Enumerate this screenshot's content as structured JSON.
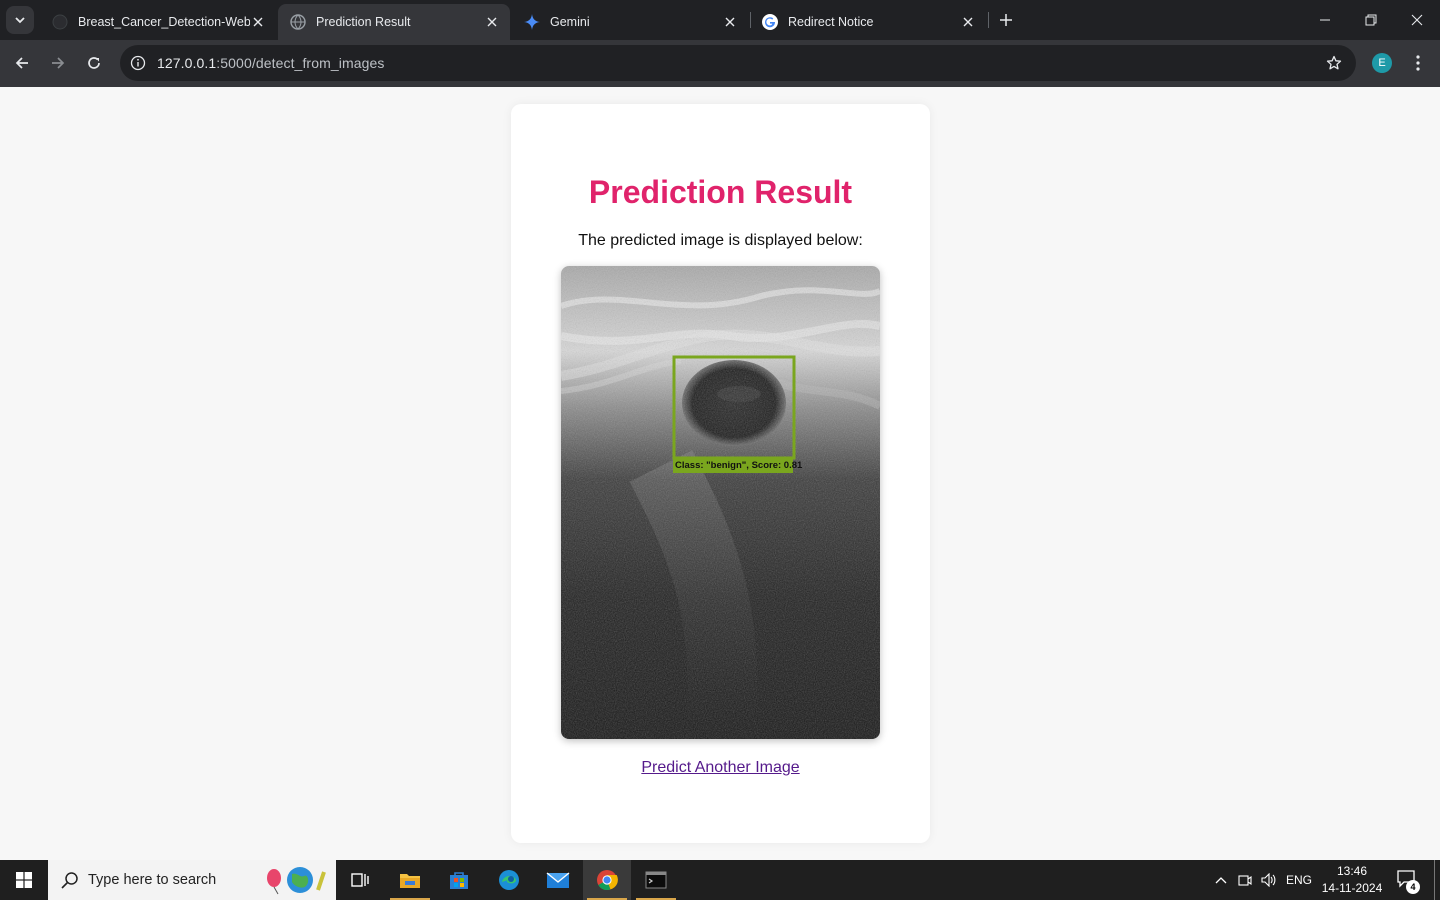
{
  "browser": {
    "tabs": [
      {
        "title": "Breast_Cancer_Detection-Web_",
        "active": false,
        "favicon": "github-icon"
      },
      {
        "title": "Prediction Result",
        "active": true,
        "favicon": "globe-icon"
      },
      {
        "title": "Gemini",
        "active": false,
        "favicon": "gemini-sparkle-icon"
      },
      {
        "title": "Redirect Notice",
        "active": false,
        "favicon": "google-g-icon"
      }
    ],
    "url_host": "127.0.0.1",
    "url_path": ":5000/detect_from_images",
    "profile_initial": "E"
  },
  "page": {
    "heading": "Prediction Result",
    "subtitle": "The predicted image is displayed below:",
    "detection_label": "Class: \"benign\", Score: 0.81",
    "link_text": "Predict Another Image"
  },
  "colors": {
    "heading": "#e0236b",
    "bbox": "#7aa61e",
    "link": "#551a8b"
  },
  "taskbar": {
    "search_placeholder": "Type here to search",
    "language": "ENG",
    "time": "13:46",
    "date": "14-11-2024",
    "notification_count": "4"
  }
}
